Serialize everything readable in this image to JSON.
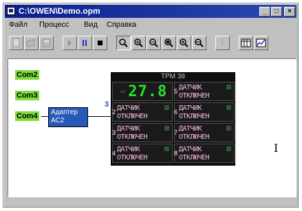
{
  "window": {
    "title": "C:\\OWEN\\Demo.opm",
    "controls": [
      "_",
      "□",
      "×"
    ]
  },
  "menu": [
    "Файл",
    "Процесс",
    "Вид",
    "Справка"
  ],
  "toolbar": {
    "icons": [
      "new-icon",
      "open-icon",
      "save-icon",
      "step-icon",
      "pause-icon",
      "stop-icon",
      "zoom-icon",
      "zoom-in-icon",
      "zoom-out-icon",
      "zoom-area-icon",
      "zoom-prev-icon",
      "zoom-fit-icon",
      "info-icon",
      "table-icon",
      "chart-icon"
    ],
    "info_label": "i"
  },
  "ports": [
    {
      "label": "Com2"
    },
    {
      "label": "Com3"
    },
    {
      "label": "Com4"
    }
  ],
  "adapter": {
    "line1": "Адаптер",
    "line2": "АС2"
  },
  "port_number": "3",
  "device": {
    "title": "ТРМ 38",
    "channels": [
      {
        "num": "",
        "display": "27.8",
        "lead": "-",
        "type": "value"
      },
      {
        "num": "5",
        "line1": "ДАТЧИК",
        "line2": "ОТКЛЮЧЕН",
        "type": "status"
      },
      {
        "num": "2",
        "line1": "ДАТЧИК",
        "line2": "ОТКЛЮЧЕН",
        "type": "status"
      },
      {
        "num": "6",
        "line1": "ДАТЧИК",
        "line2": "ОТКЛЮЧЕН",
        "type": "status"
      },
      {
        "num": "3",
        "line1": "ДАТЧИК",
        "line2": "ОТКЛЮЧЕН",
        "type": "status"
      },
      {
        "num": "7",
        "line1": "ДАТЧИК",
        "line2": "ОТКЛЮЧЕН",
        "type": "status"
      },
      {
        "num": "4",
        "line1": "ДАТЧИК",
        "line2": "ОТКЛЮЧЕН",
        "type": "status"
      },
      {
        "num": "8",
        "line1": "ДАТЧИК",
        "line2": "ОТКЛЮЧЕН",
        "type": "status"
      }
    ]
  },
  "colors": {
    "titlebar": "#0a1e8c",
    "com_green": "#7ddc3c",
    "adapter_blue": "#2858b8",
    "display_green": "#28e028",
    "status_pink": "#f7b4e4"
  }
}
